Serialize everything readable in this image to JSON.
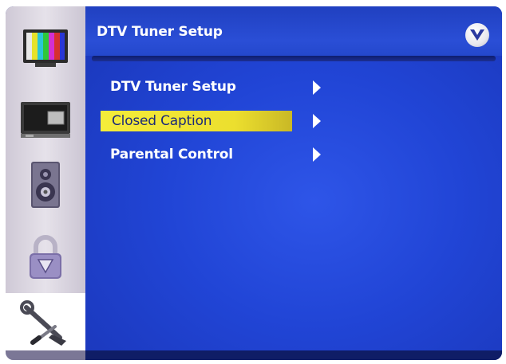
{
  "header": {
    "title": "DTV Tuner Setup",
    "brand_icon": "vizio-v-logo-icon"
  },
  "sidebar": {
    "items": [
      {
        "icon": "picture-color-bars-icon",
        "active": false
      },
      {
        "icon": "tv-input-icon",
        "active": false
      },
      {
        "icon": "speaker-audio-icon",
        "active": false
      },
      {
        "icon": "padlock-parental-icon",
        "active": false
      },
      {
        "icon": "wrench-setup-icon",
        "active": true
      }
    ]
  },
  "menu": {
    "items": [
      {
        "label": "DTV Tuner Setup",
        "selected": false,
        "arrow_icon": "chevron-right-icon"
      },
      {
        "label": "Closed Caption",
        "selected": true,
        "arrow_icon": "chevron-right-icon"
      },
      {
        "label": "Parental Control",
        "selected": false,
        "arrow_icon": "chevron-right-icon"
      }
    ]
  },
  "colors": {
    "panel_blue": "#2448d8",
    "highlight_yellow": "#f0e634",
    "sidebar_gray": "#d6d1dd",
    "text_white": "#ffffff"
  }
}
